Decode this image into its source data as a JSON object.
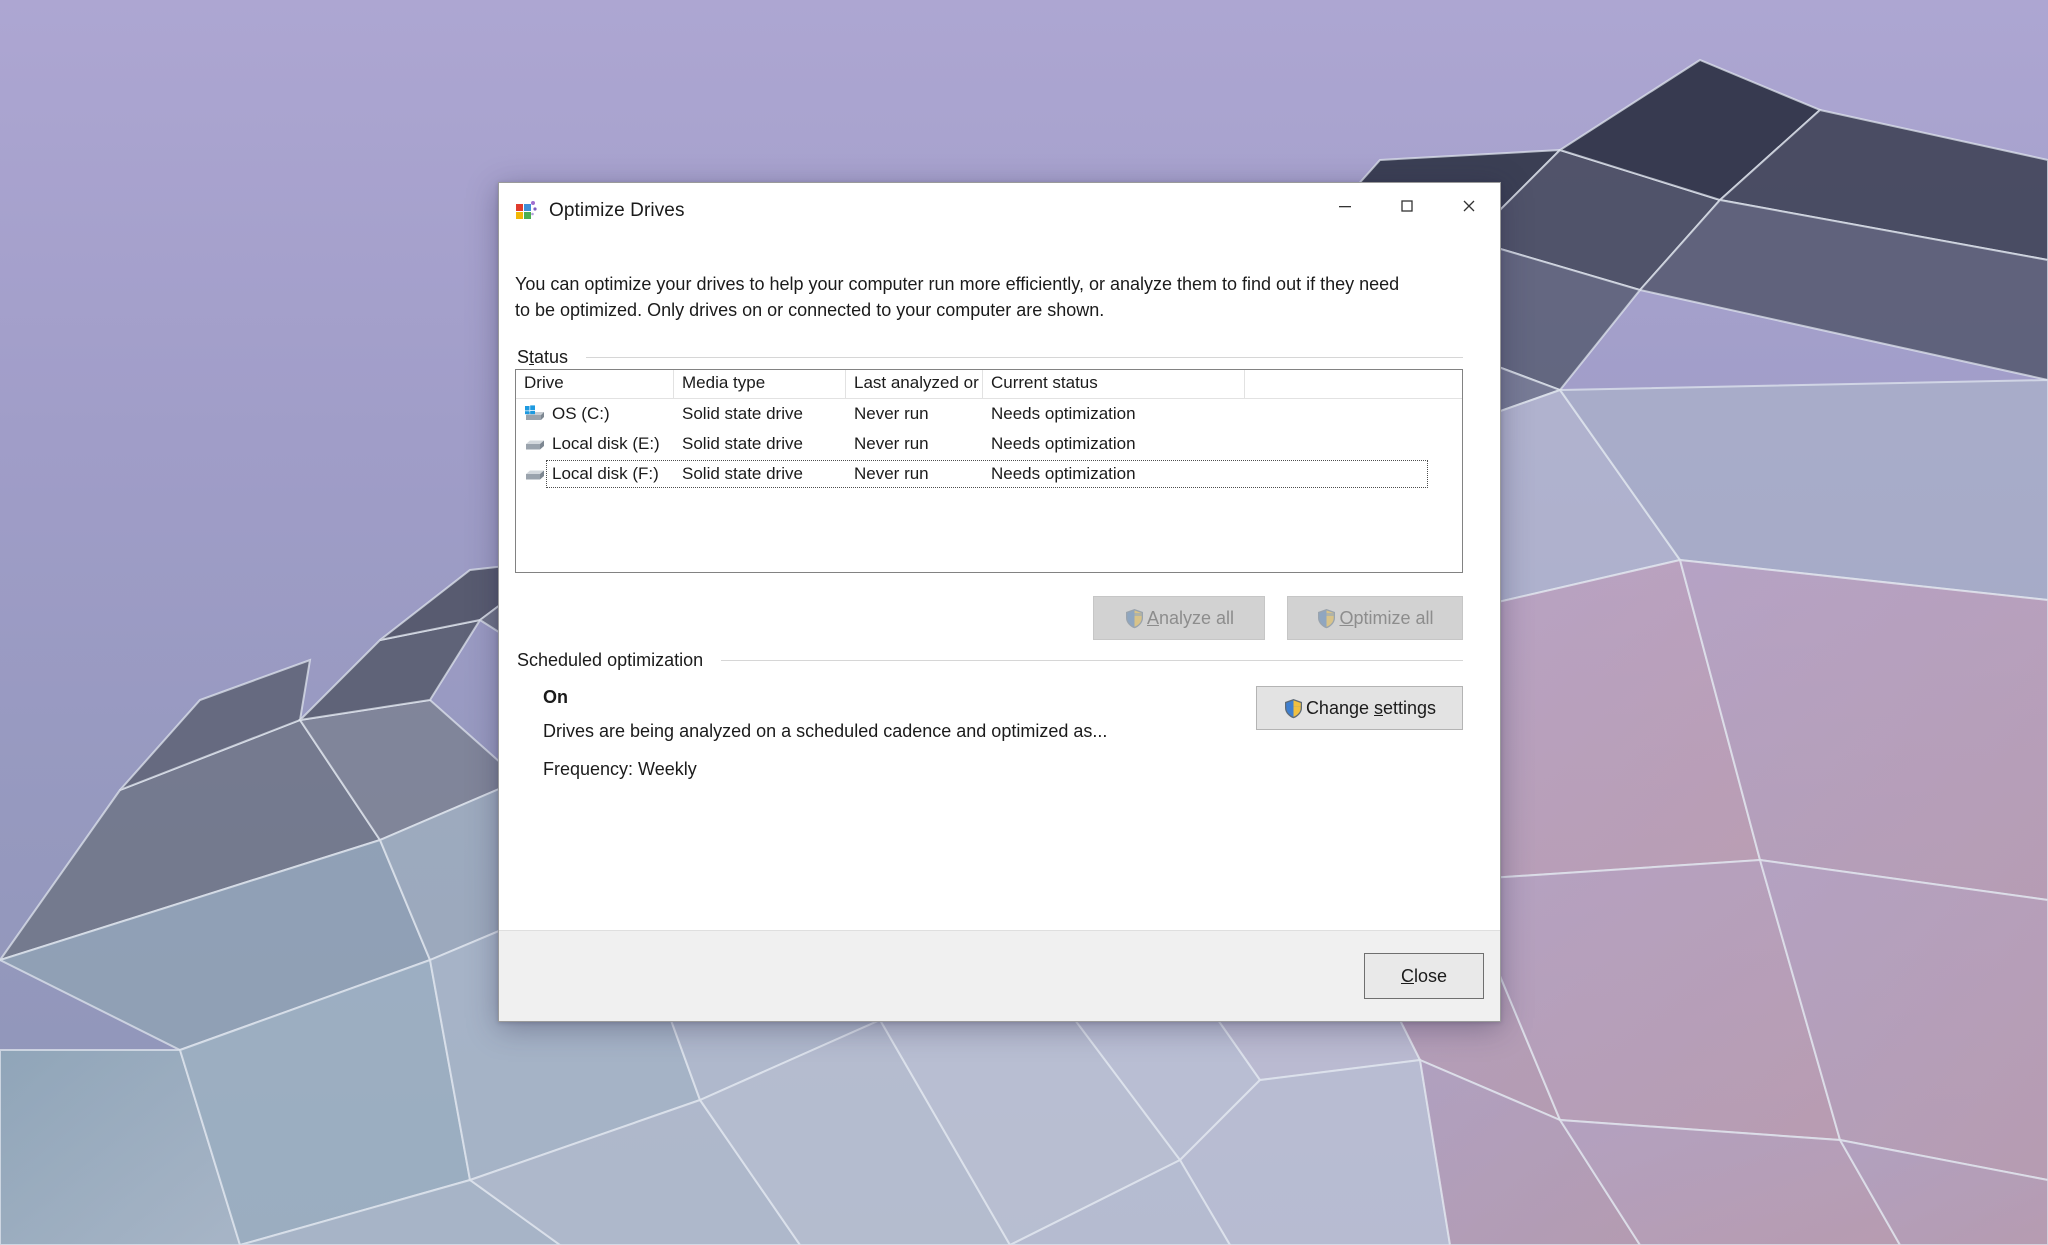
{
  "window": {
    "title": "Optimize Drives",
    "icon": "optimize-drives-icon",
    "controls": {
      "minimize": "minimize-icon",
      "maximize": "maximize-icon",
      "close": "close-icon"
    }
  },
  "intro": {
    "text": "You can optimize your drives to help your computer run more efficiently, or analyze them to find out if they need to be optimized. Only drives on or connected to your computer are shown."
  },
  "status_group": {
    "label": "Status",
    "accelerator": "t"
  },
  "drive_table": {
    "columns": [
      "Drive",
      "Media type",
      "Last analyzed or ...",
      "Current status",
      ""
    ],
    "rows": [
      {
        "drive": "OS (C:)",
        "icon": "windows-drive-icon",
        "media_type": "Solid state drive",
        "last_analyzed": "Never run",
        "current_status": "Needs optimization",
        "focused": false
      },
      {
        "drive": "Local disk (E:)",
        "icon": "drive-icon",
        "media_type": "Solid state drive",
        "last_analyzed": "Never run",
        "current_status": "Needs optimization",
        "focused": false
      },
      {
        "drive": "Local disk (F:)",
        "icon": "drive-icon",
        "media_type": "Solid state drive",
        "last_analyzed": "Never run",
        "current_status": "Needs optimization",
        "focused": true
      }
    ]
  },
  "actions": {
    "analyze_all": {
      "label": "Analyze all",
      "accel_index": 0,
      "enabled": false,
      "icon": "uac-shield-icon"
    },
    "optimize_all": {
      "label": "Optimize all",
      "accel_index": 0,
      "enabled": false,
      "icon": "uac-shield-icon"
    }
  },
  "scheduled_group": {
    "label": "Scheduled optimization",
    "state": "On",
    "description": "Drives are being analyzed on a scheduled cadence and optimized as...",
    "frequency": "Frequency: Weekly",
    "change_settings": {
      "label": "Change settings",
      "accel_char": "s",
      "enabled": true,
      "icon": "uac-shield-icon"
    }
  },
  "footer": {
    "close": {
      "label": "Close",
      "accel_char": "C",
      "is_default": true
    }
  },
  "colors": {
    "window_background": "#ffffff",
    "footer_background": "#f0f0f0",
    "text": "#1b1b1b",
    "disabled_text": "#8d8d8d",
    "list_border": "#828282",
    "group_rule": "#d6d6d6",
    "desktop_gradient_top": "#ada6d2",
    "desktop_gradient_bottom": "#9096b9",
    "uac_shield_blue": "#3f7fcf",
    "uac_shield_gold": "#f0c040",
    "windows_badge_blue": "#1e9ae0"
  }
}
